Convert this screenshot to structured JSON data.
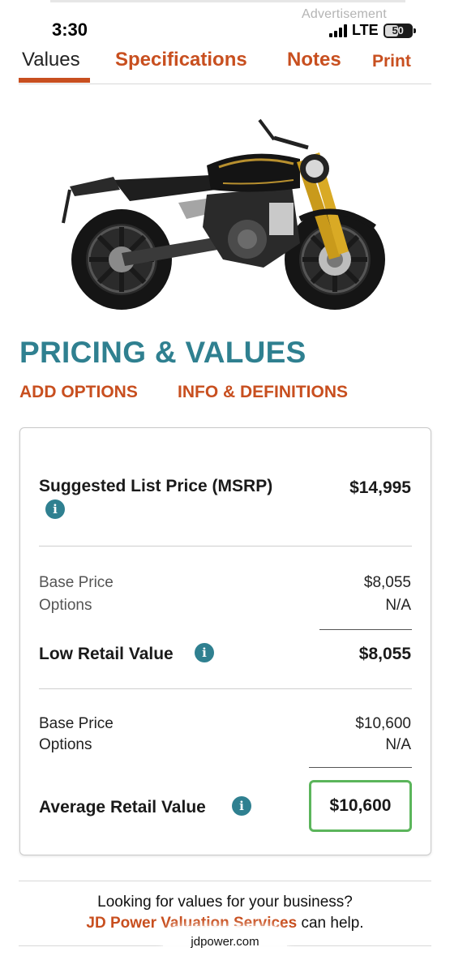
{
  "status_bar": {
    "time": "3:30",
    "network": "LTE",
    "battery": "50",
    "battery_level": 0.5
  },
  "ad": {
    "label": "Advertisement"
  },
  "tabs": [
    {
      "label": "Values",
      "active": true
    },
    {
      "label": "Specifications",
      "active": false
    },
    {
      "label": "Notes",
      "active": false
    },
    {
      "label": "Print",
      "active": false
    }
  ],
  "product_image": {
    "icon": "motorcycle-photo"
  },
  "section": {
    "title": "PRICING & VALUES",
    "links": {
      "add_options": "ADD OPTIONS",
      "info_definitions": "INFO & DEFINITIONS"
    }
  },
  "pricing": {
    "msrp": {
      "label": "Suggested List Price (MSRP)",
      "value": "$14,995"
    },
    "low": {
      "base_label": "Base Price",
      "base_value": "$8,055",
      "options_label": "Options",
      "options_value": "N/A",
      "total_label": "Low Retail Value",
      "total_value": "$8,055"
    },
    "average": {
      "base_label": "Base Price",
      "base_value": "$10,600",
      "options_label": "Options",
      "options_value": "N/A",
      "total_label": "Average Retail Value",
      "total_value": "$10,600"
    },
    "info_glyph": "i"
  },
  "footer": {
    "question": "Looking for values for your business?",
    "brand": "JD Power Valuation Services",
    "suffix": " can help."
  },
  "browser": {
    "url": "jdpower.com"
  },
  "colors": {
    "accent": "#c84f1f",
    "teal": "#2f8090",
    "highlight_border": "#5bb55b"
  }
}
